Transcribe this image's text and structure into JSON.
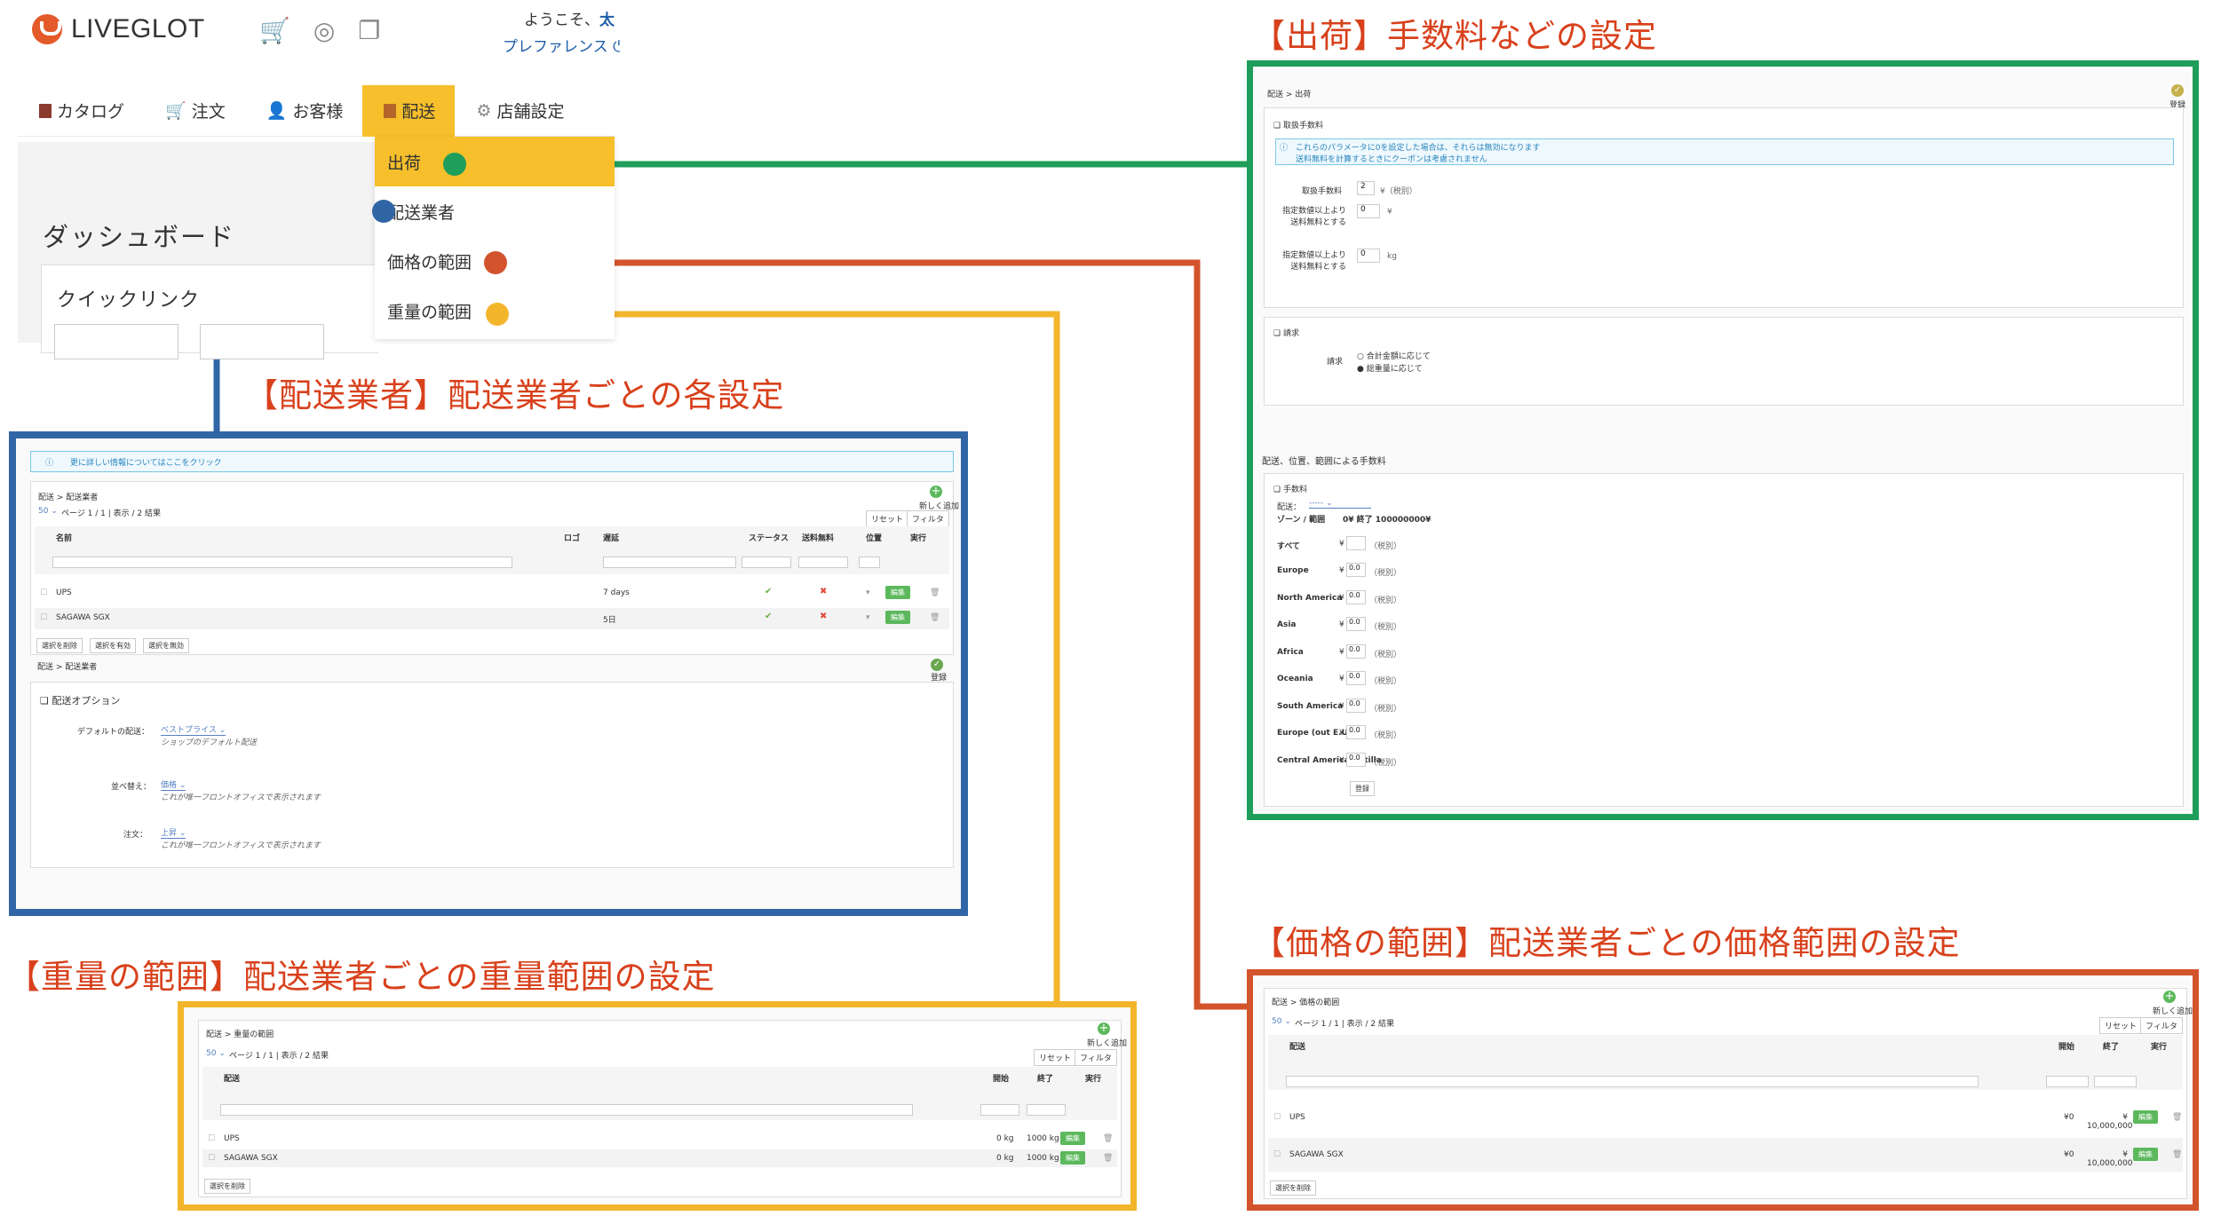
{
  "header": {
    "logo_text": "LIVEGLOT",
    "welcome_prefix": "ようこそ、",
    "welcome_name": "太",
    "preferences": "プレファレンス"
  },
  "nav": {
    "catalog": "カタログ",
    "orders": "注文",
    "customers": "お客様",
    "shipping": "配送",
    "store_settings": "店舗設定"
  },
  "dropdown": {
    "shipment": "出荷",
    "carriers": "配送業者",
    "price_ranges": "価格の範囲",
    "weight_ranges": "重量の範囲"
  },
  "dashboard": {
    "title": "ダッシュボード",
    "quick_links": "クイックリンク"
  },
  "annotations": {
    "shipment": "【出荷】手数料などの設定",
    "carriers": "【配送業者】配送業者ごとの各設定",
    "weight": "【重量の範囲】配送業者ごとの重量範囲の設定",
    "price": "【価格の範囲】配送業者ごとの価格範囲の設定"
  },
  "colors": {
    "shipment": "#1e9e5a",
    "carriers": "#3166a6",
    "weight": "#f2b52c",
    "price": "#d3532c",
    "active_nav": "#f6bf2b",
    "annotation_text": "#d8411c"
  },
  "shipment_panel": {
    "breadcrumb": "配送 > 出荷",
    "save": "登録",
    "handling_section": "取扱手数料",
    "info_line1": "これらのパラメータに0を設定した場合は、それらは無効になります",
    "info_line2": "送料無料を計算するときにクーポンは考慮されません",
    "handling_label": "取扱手数料",
    "handling_value": "2",
    "handling_unit": "¥（税別）",
    "free_price_label": "指定数値以上より送料無料とする",
    "free_price_value": "0",
    "free_price_unit": "¥",
    "free_weight_label": "指定数値以上より送料無料とする",
    "free_weight_value": "0",
    "free_weight_unit": "kg",
    "billing_section": "請求",
    "billing_label": "請求",
    "billing_opt1": "合計金額に応じて",
    "billing_opt2": "総重量に応じて",
    "fees_heading": "配送、位置、範囲による手数料",
    "fees_section": "手数料",
    "carrier_label": "配送：",
    "carrier_value": "-----",
    "zone_header": "ゾーン / 範囲",
    "range_header": "0¥ 終了 100000000¥",
    "all_zones": "すべて",
    "tax": "（税別）",
    "currency": "¥",
    "zones": [
      {
        "name": "Europe",
        "value": "0.0"
      },
      {
        "name": "North America",
        "value": "0.0"
      },
      {
        "name": "Asia",
        "value": "0.0"
      },
      {
        "name": "Africa",
        "value": "0.0"
      },
      {
        "name": "Oceania",
        "value": "0.0"
      },
      {
        "name": "South America",
        "value": "0.0"
      },
      {
        "name": "Europe (out E.U)",
        "value": "0.0"
      },
      {
        "name": "Central America/Antilla",
        "value": "0.0"
      }
    ],
    "save_bottom": "登録"
  },
  "carriers_panel": {
    "info": "更に詳しい情報についてはここをクリック",
    "breadcrumb": "配送 > 配送業者",
    "add_new": "新しく追加",
    "page_info": "ページ 1 / 1 | 表示 / 2 結果",
    "reset": "リセット",
    "filter": "フィルタ",
    "columns": {
      "name": "名前",
      "logo": "ロゴ",
      "delay": "遅延",
      "status": "ステータス",
      "free_shipping": "送料無料",
      "position": "位置",
      "action": "実行"
    },
    "rows": [
      {
        "name": "UPS",
        "delay": "7 days"
      },
      {
        "name": "SAGAWA SGX",
        "delay": "5日"
      }
    ],
    "edit": "編集",
    "bulk_delete": "選択を削除",
    "bulk_enable": "選択を有効",
    "bulk_disable": "選択を無効",
    "breadcrumb2": "配送 > 配送業者",
    "save": "登録",
    "options_title": "配送オプション",
    "default_carrier_label": "デフォルトの配送：",
    "default_carrier_value": "ベストプライス",
    "default_carrier_hint": "ショップのデフォルト配送",
    "sort_label": "並べ替え：",
    "sort_value": "価格",
    "sort_hint": "これが唯一フロントオフィスで表示されます",
    "order_label": "注文：",
    "order_value": "上昇",
    "order_hint": "これが唯一フロントオフィスで表示されます"
  },
  "weight_panel": {
    "breadcrumb": "配送 > 重量の範囲",
    "add_new": "新しく追加",
    "page_info": "ページ 1 / 1 | 表示 / 2 結果",
    "reset": "リセット",
    "filter": "フィルタ",
    "col_carrier": "配送",
    "col_start": "開始",
    "col_end": "終了",
    "col_action": "実行",
    "rows": [
      {
        "carrier": "UPS",
        "start": "0 kg",
        "end": "1000 kg"
      },
      {
        "carrier": "SAGAWA SGX",
        "start": "0 kg",
        "end": "1000 kg"
      }
    ],
    "edit": "編集",
    "bulk_delete": "選択を削除"
  },
  "price_panel": {
    "breadcrumb": "配送 > 価格の範囲",
    "add_new": "新しく追加",
    "page_info": "ページ 1 / 1 | 表示 / 2 結果",
    "reset": "リセット",
    "filter": "フィルタ",
    "col_carrier": "配送",
    "col_start": "開始",
    "col_end": "終了",
    "col_action": "実行",
    "rows": [
      {
        "carrier": "UPS",
        "start": "¥0",
        "end": "¥ 10,000,000"
      },
      {
        "carrier": "SAGAWA SGX",
        "start": "¥0",
        "end": "¥ 10,000,000"
      }
    ],
    "edit": "編集",
    "bulk_delete": "選択を削除"
  }
}
